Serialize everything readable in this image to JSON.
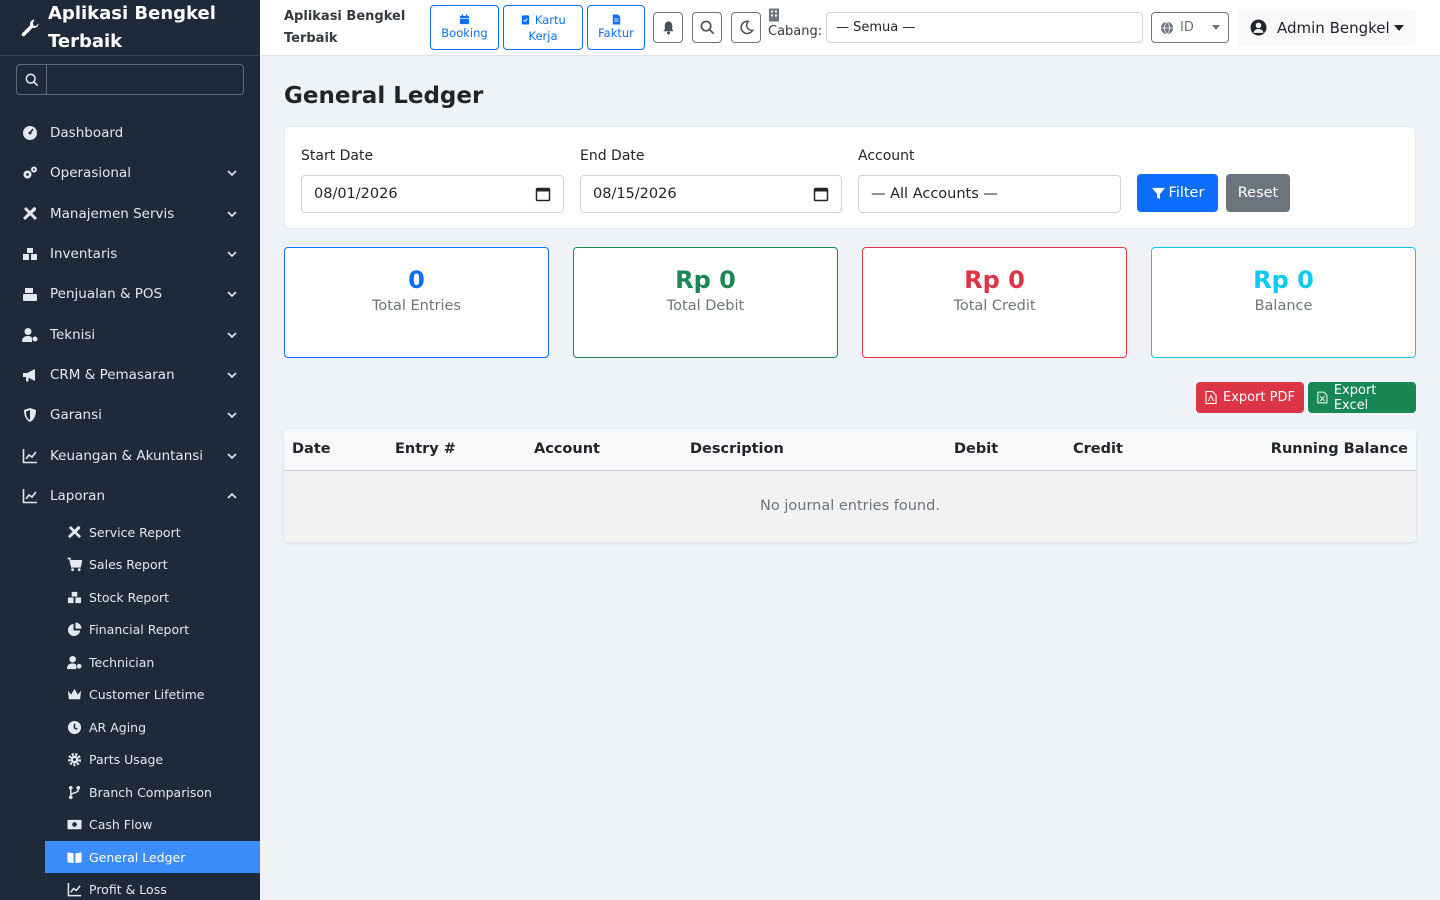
{
  "app": {
    "brand": "Aplikasi Bengkel Terbaik"
  },
  "sidebar": {
    "search_placeholder": "",
    "items": [
      {
        "label": "Dashboard",
        "icon": "dashboard-icon"
      },
      {
        "label": "Operasional",
        "icon": "cogs-icon"
      },
      {
        "label": "Manajemen Servis",
        "icon": "tools-icon"
      },
      {
        "label": "Inventaris",
        "icon": "boxes-icon"
      },
      {
        "label": "Penjualan & POS",
        "icon": "cash-register-icon"
      },
      {
        "label": "Teknisi",
        "icon": "user-gear-icon"
      },
      {
        "label": "CRM & Pemasaran",
        "icon": "bullhorn-icon"
      },
      {
        "label": "Garansi",
        "icon": "shield-icon"
      },
      {
        "label": "Keuangan & Akuntansi",
        "icon": "chart-line-icon"
      },
      {
        "label": "Laporan",
        "icon": "chart-line-icon"
      }
    ],
    "report_items": [
      {
        "label": "Service Report",
        "icon": "tools-icon"
      },
      {
        "label": "Sales Report",
        "icon": "cart-icon"
      },
      {
        "label": "Stock Report",
        "icon": "boxes-icon"
      },
      {
        "label": "Financial Report",
        "icon": "pie-chart-icon"
      },
      {
        "label": "Technician",
        "icon": "user-gear-icon"
      },
      {
        "label": "Customer Lifetime",
        "icon": "crown-icon"
      },
      {
        "label": "AR Aging",
        "icon": "clock-icon"
      },
      {
        "label": "Parts Usage",
        "icon": "cog-icon"
      },
      {
        "label": "Branch Comparison",
        "icon": "branch-icon"
      },
      {
        "label": "Cash Flow",
        "icon": "money-icon"
      },
      {
        "label": "General Ledger",
        "icon": "book-open-icon"
      },
      {
        "label": "Profit & Loss",
        "icon": "chart-line-icon"
      }
    ]
  },
  "topbar": {
    "title": "Aplikasi Bengkel Terbaik",
    "quick": {
      "booking": "Booking",
      "kartu_kerja": "Kartu Kerja",
      "faktur": "Faktur"
    },
    "cabang_label": "Cabang:",
    "branch_value": "— Semua —",
    "lang": "ID",
    "user": "Admin Bengkel"
  },
  "page": {
    "title": "General Ledger",
    "filters": {
      "start_label": "Start Date",
      "start_value": "08/01/2026",
      "end_label": "End Date",
      "end_value": "08/15/2026",
      "account_label": "Account",
      "account_value": "— All Accounts —",
      "filter_button": "Filter",
      "reset_button": "Reset"
    },
    "stats": {
      "entries_value": "0",
      "entries_label": "Total Entries",
      "debit_value": "Rp 0",
      "debit_label": "Total Debit",
      "credit_value": "Rp 0",
      "credit_label": "Total Credit",
      "balance_value": "Rp 0",
      "balance_label": "Balance"
    },
    "export": {
      "pdf": "Export PDF",
      "excel": "Export Excel"
    },
    "table": {
      "headers": {
        "date": "Date",
        "entry": "Entry #",
        "account": "Account",
        "description": "Description",
        "debit": "Debit",
        "credit": "Credit",
        "running": "Running Balance"
      },
      "empty": "No journal entries found."
    }
  },
  "colors": {
    "primary": "#0d6efd",
    "success": "#198754",
    "danger": "#dc3545",
    "info": "#0dcaf0",
    "sidebar": "#1e2a3a",
    "active": "#3c8dfc"
  }
}
